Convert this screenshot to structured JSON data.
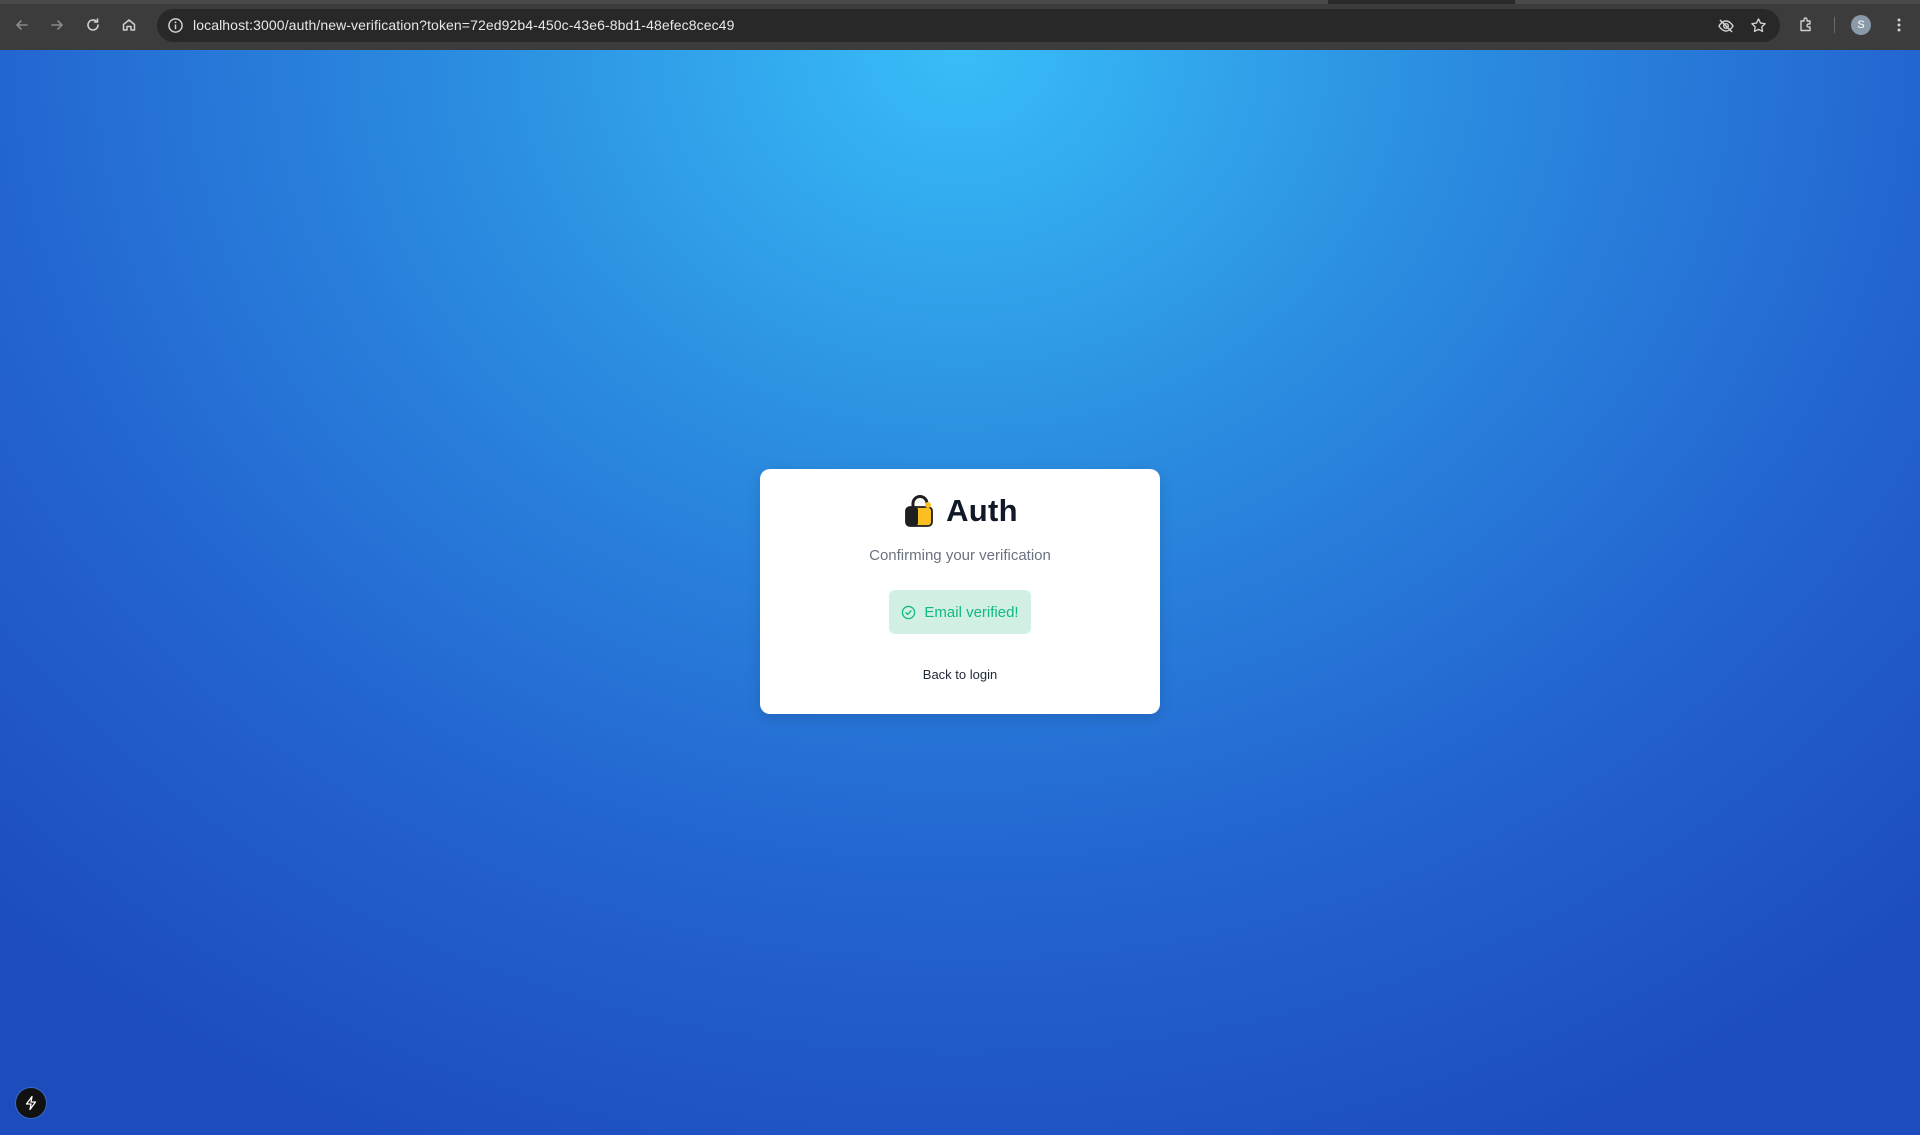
{
  "browser": {
    "url": "localhost:3000/auth/new-verification?token=72ed92b4-450c-43e6-8bd1-48efec8cec49",
    "profile_initial": "S",
    "icons": {
      "back": "arrow-left-icon",
      "forward": "arrow-right-icon",
      "reload": "reload-icon",
      "home": "home-icon",
      "site_info": "info-icon",
      "tracking": "eye-off-icon",
      "bookmark": "star-icon",
      "extensions": "puzzle-icon",
      "menu": "kebab-menu-icon"
    }
  },
  "page": {
    "background_colors": [
      "#38bdf8",
      "#1d4dbd"
    ],
    "card": {
      "logo_icon": "lock-icon",
      "title": "Auth",
      "subtitle": "Confirming your verification",
      "alert": {
        "icon": "check-circle-icon",
        "message": "Email verified!",
        "color": "#10b981",
        "background": "#d1f0e3"
      },
      "back_link": "Back to login"
    },
    "devtools_badge_icon": "lightning-icon"
  }
}
